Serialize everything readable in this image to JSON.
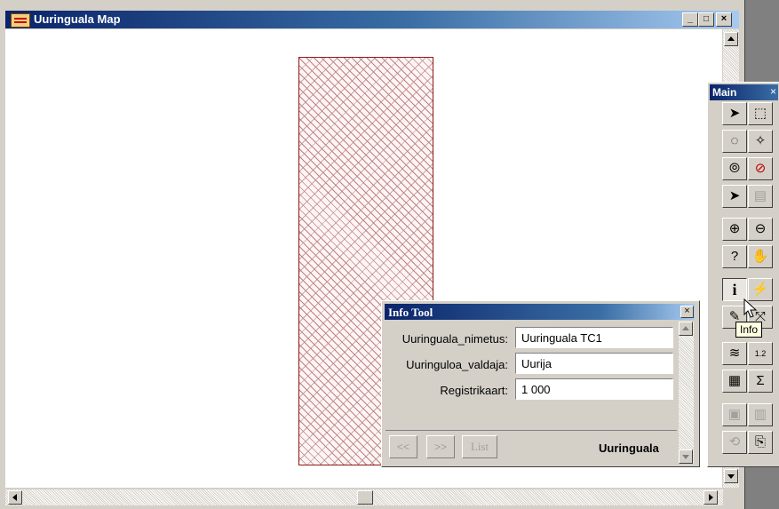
{
  "window": {
    "title": "Uuringuala Map",
    "controls": {
      "minimize": "_",
      "maximize": "□",
      "close": "×"
    }
  },
  "main_toolbar": {
    "title": "Main",
    "close": "×",
    "tools": [
      {
        "icon": "select-arrow-icon",
        "glyph": "➤"
      },
      {
        "icon": "rect-select-icon",
        "glyph": "⬚"
      },
      {
        "icon": "radius-select-icon",
        "glyph": "◌"
      },
      {
        "icon": "polygon-select-icon",
        "glyph": "✧"
      },
      {
        "icon": "boundary-select-icon",
        "glyph": "⦾"
      },
      {
        "icon": "unselect-icon",
        "glyph": "⊘"
      },
      {
        "icon": "invert-select-icon",
        "glyph": "➤"
      },
      {
        "icon": "graphic-select-icon",
        "glyph": "▤"
      },
      {
        "icon": "zoom-in-icon",
        "glyph": "⊕"
      },
      {
        "icon": "zoom-out-icon",
        "glyph": "⊖"
      },
      {
        "icon": "change-view-icon",
        "glyph": "?"
      },
      {
        "icon": "grabber-hand-icon",
        "glyph": "✋"
      },
      {
        "icon": "info-icon",
        "glyph": "i"
      },
      {
        "icon": "hotlink-icon",
        "glyph": "⚡"
      },
      {
        "icon": "label-icon",
        "glyph": "✎"
      },
      {
        "icon": "drag-map-icon",
        "glyph": "⤧"
      },
      {
        "icon": "layer-control-icon",
        "glyph": "≋"
      },
      {
        "icon": "ruler-icon",
        "glyph": "1.2"
      },
      {
        "icon": "legend-icon",
        "glyph": "▦"
      },
      {
        "icon": "statistics-icon",
        "glyph": "Σ"
      },
      {
        "icon": "clip-region-icon",
        "glyph": "▣"
      },
      {
        "icon": "set-clip-icon",
        "glyph": "▥"
      },
      {
        "icon": "show-statusbar-icon",
        "glyph": "⟲"
      },
      {
        "icon": "options-icon",
        "glyph": "⎘"
      }
    ]
  },
  "tooltip": "Info",
  "info_tool": {
    "title": "Info Tool",
    "close": "×",
    "fields": [
      {
        "label": "Uuringuala_nimetus:",
        "value": "Uuringuala TC1"
      },
      {
        "label": "Uuringuloa_valdaja:",
        "value": "Uurija"
      },
      {
        "label": "Registrikaart:",
        "value": "1 000"
      }
    ],
    "buttons": {
      "prev": "<<",
      "next": ">>",
      "list": "List"
    },
    "layer_name": "Uuringuala"
  }
}
